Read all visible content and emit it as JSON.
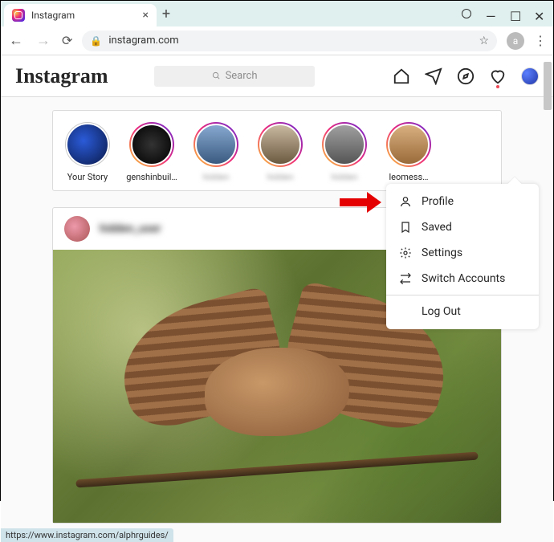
{
  "browser": {
    "tab_title": "Instagram",
    "url": "instagram.com",
    "profile_letter": "a",
    "status_link": "https://www.instagram.com/alphrguides/"
  },
  "nav": {
    "logo": "Instagram",
    "search_placeholder": "Search"
  },
  "stories": [
    {
      "label": "Your Story",
      "own": true
    },
    {
      "label": "genshinbuil…",
      "own": false
    },
    {
      "label": "hidden",
      "own": false,
      "blur": true
    },
    {
      "label": "hidden",
      "own": false,
      "blur": true
    },
    {
      "label": "hidden",
      "own": false,
      "blur": true
    },
    {
      "label": "leomess…",
      "own": false
    }
  ],
  "post": {
    "username": "hidden_user"
  },
  "menu": {
    "profile": "Profile",
    "saved": "Saved",
    "settings": "Settings",
    "switch": "Switch Accounts",
    "logout": "Log Out"
  }
}
